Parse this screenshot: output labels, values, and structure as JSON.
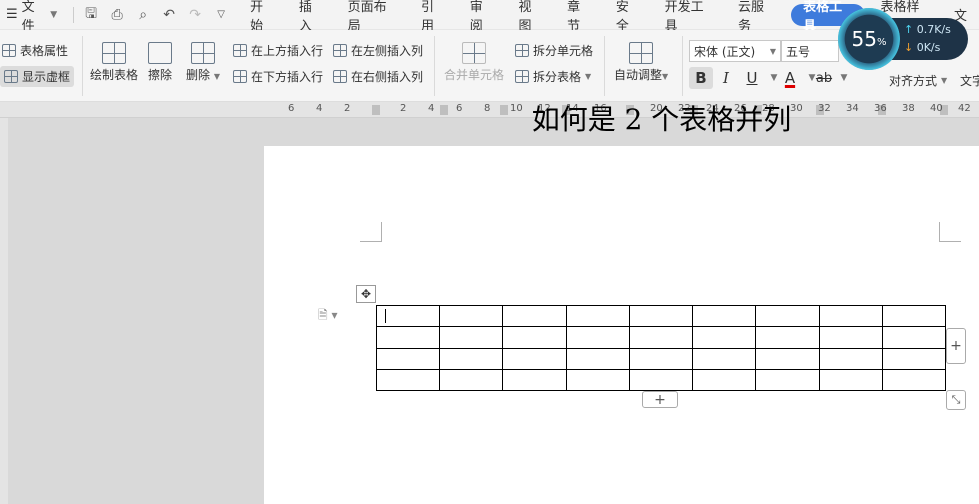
{
  "menubar": {
    "file_label": "文件",
    "tabs": [
      "开始",
      "插入",
      "页面布局",
      "引用",
      "审阅",
      "视图",
      "章节",
      "安全",
      "开发工具",
      "云服务",
      "表格工具",
      "表格样式",
      "文"
    ]
  },
  "ribbon": {
    "table_properties": "表格属性",
    "show_gridlines": "显示虚框",
    "draw_table": "绘制表格",
    "erase": "擦除",
    "delete": "删除",
    "insert_row_above": "在上方插入行",
    "insert_row_below": "在下方插入行",
    "insert_col_left": "在左侧插入列",
    "insert_col_right": "在右侧插入列",
    "merge_cells": "合并单元格",
    "split_cells": "拆分单元格",
    "split_table": "拆分表格",
    "auto_fit": "自动调整",
    "font_name": "宋体 (正文)",
    "font_size": "五号",
    "bold": "B",
    "italic": "I",
    "underline": "U",
    "font_color": "A",
    "highlight": "ab",
    "align": "对齐方式",
    "text_dir": "文字"
  },
  "speed": {
    "percent": "55",
    "percent_sign": "%",
    "upload": "0.7",
    "download": "0",
    "unit": "K/s"
  },
  "ruler": {
    "labels": [
      "6",
      "4",
      "2",
      "2",
      "4",
      "6",
      "8",
      "10",
      "12",
      "14",
      "16",
      "20",
      "22",
      "24",
      "26",
      "28",
      "30",
      "32",
      "34",
      "36",
      "38",
      "40",
      "42"
    ]
  },
  "document": {
    "title": "如何是 2 个表格并列",
    "table": {
      "rows": 4,
      "cols": 9
    }
  },
  "colors": {
    "accent": "#3e7bdc",
    "page": "#ffffff",
    "workspace": "#d9d9d9"
  }
}
